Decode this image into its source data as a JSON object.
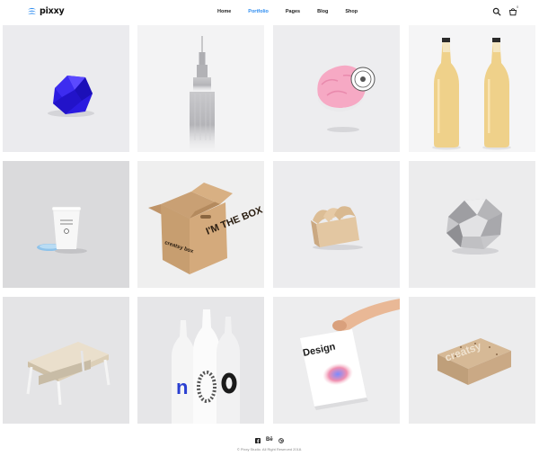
{
  "brand": {
    "name": "pixxy",
    "accent": "#2d8cf0"
  },
  "nav": {
    "items": [
      {
        "label": "Home",
        "active": false
      },
      {
        "label": "Portfolio",
        "active": true
      },
      {
        "label": "Pages",
        "active": false
      },
      {
        "label": "Blog",
        "active": false
      },
      {
        "label": "Shop",
        "active": false
      }
    ]
  },
  "header_icons": {
    "search": "search-icon",
    "cart": "cart-icon",
    "cart_count": "0"
  },
  "portfolio": {
    "tiles": [
      {
        "subject": "blue-polyhedron"
      },
      {
        "subject": "skyscraper"
      },
      {
        "subject": "ice-cream-scoop"
      },
      {
        "subject": "glass-bottles"
      },
      {
        "subject": "paper-cup"
      },
      {
        "subject": "cardboard-box"
      },
      {
        "subject": "wooden-stand"
      },
      {
        "subject": "crumpled-paper"
      },
      {
        "subject": "coffee-table"
      },
      {
        "subject": "white-bottles"
      },
      {
        "subject": "design-poster"
      },
      {
        "subject": "kraft-box"
      }
    ],
    "box_text": "I'M THE BOX",
    "box_brand": "creatsy box",
    "poster_text": "Design",
    "kraft_text": "creatsy"
  },
  "footer": {
    "socials": [
      "facebook-icon",
      "behance-icon",
      "dribbble-icon"
    ],
    "behance_label": "Bē",
    "copyright": "© Pixxy Studio. All Right Reserved 2018."
  }
}
